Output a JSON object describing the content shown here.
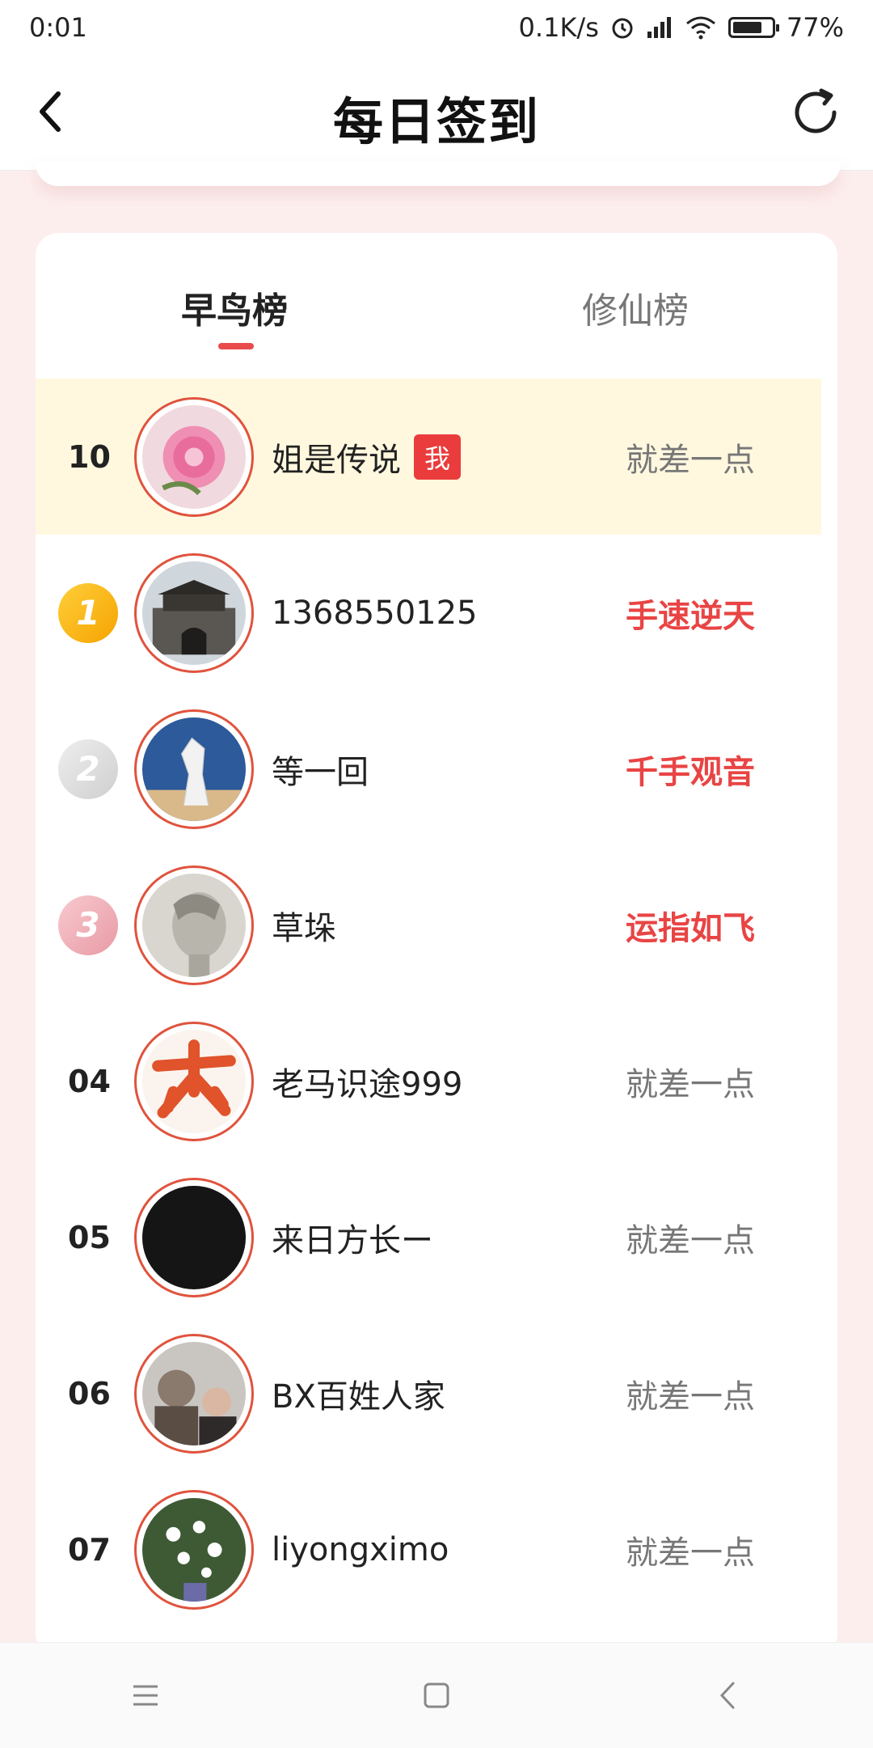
{
  "status_bar": {
    "time": "0:01",
    "speed": "0.1K/s",
    "battery": "77%",
    "battery_level": 0.77
  },
  "header": {
    "title": "每日签到"
  },
  "tabs": [
    {
      "label": "早鸟榜",
      "active": true
    },
    {
      "label": "修仙榜",
      "active": false
    }
  ],
  "rows": [
    {
      "rank": "10",
      "name": "姐是传说",
      "me_tag": "我",
      "status": "就差一点",
      "badge": "",
      "highlight": false,
      "avatar": "pink-flower"
    },
    {
      "rank": "1",
      "name": "1368550125",
      "status": "手速逆天",
      "badge": "gold",
      "highlight": true,
      "avatar": "gate-tower"
    },
    {
      "rank": "2",
      "name": "等一回",
      "status": "千手观音",
      "badge": "silver",
      "highlight": true,
      "avatar": "white-horse"
    },
    {
      "rank": "3",
      "name": "草垛",
      "status": "运指如飞",
      "badge": "bronze",
      "highlight": true,
      "avatar": "statue"
    },
    {
      "rank": "04",
      "name": "老马识途999",
      "status": "就差一点",
      "badge": "",
      "highlight": false,
      "avatar": "calligraphy"
    },
    {
      "rank": "05",
      "name": "来日方长ー",
      "status": "就差一点",
      "badge": "",
      "highlight": false,
      "avatar": "black"
    },
    {
      "rank": "06",
      "name": "BX百姓人家",
      "status": "就差一点",
      "badge": "",
      "highlight": false,
      "avatar": "couple"
    },
    {
      "rank": "07",
      "name": "liyongximo",
      "status": "就差一点",
      "badge": "",
      "highlight": false,
      "avatar": "white-flowers"
    }
  ],
  "colors": {
    "accent": "#e94b4b",
    "gold": "#f5a300",
    "highlight_row": "#fff8df"
  }
}
